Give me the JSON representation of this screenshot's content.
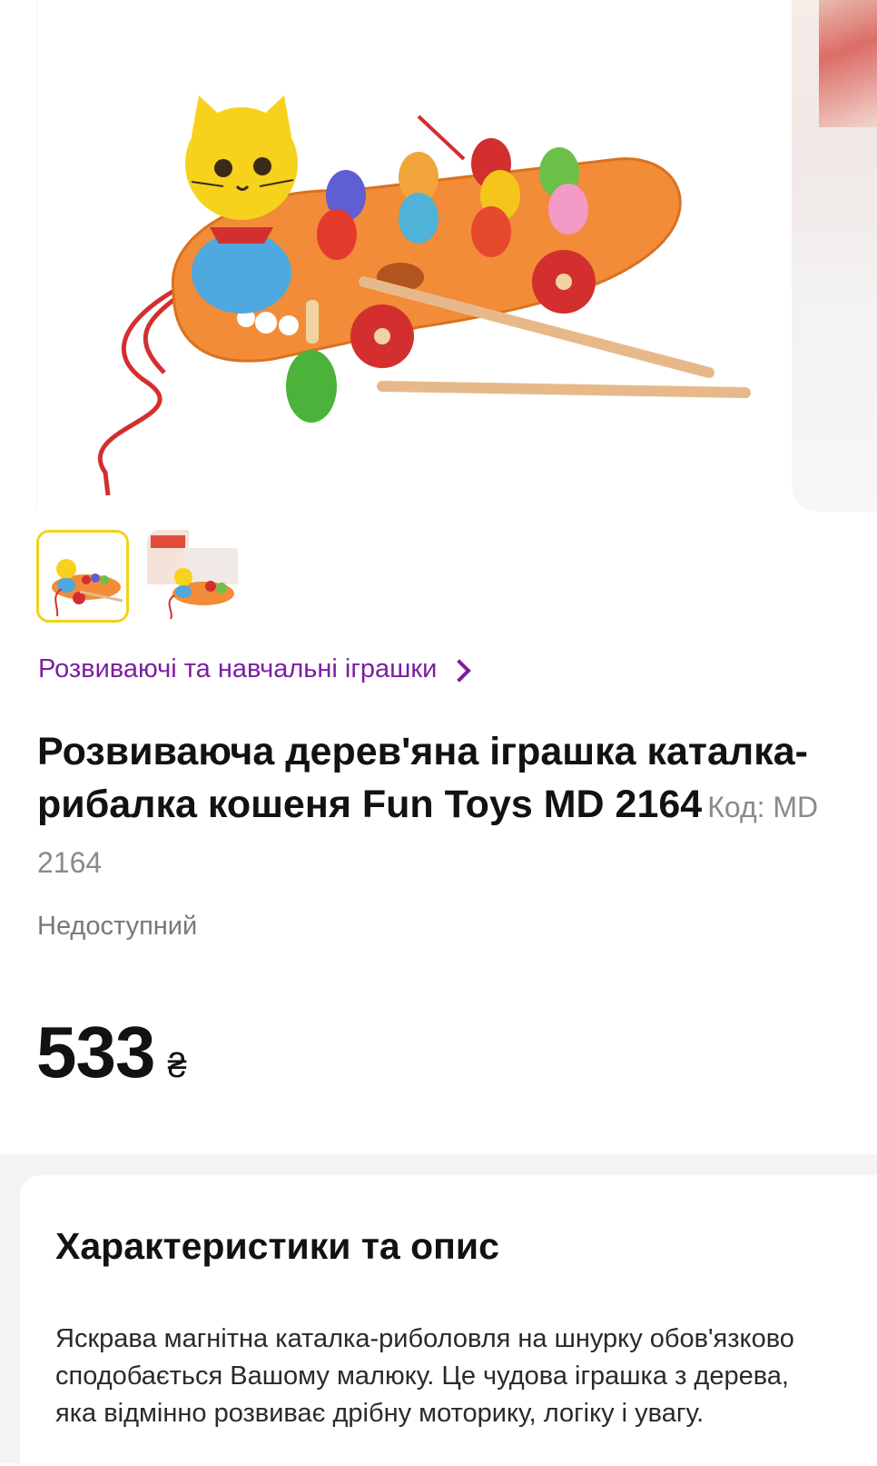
{
  "gallery": {
    "thumbnail_count": 2,
    "active_thumbnail": 1
  },
  "breadcrumb": {
    "category_label": "Розвиваючі та навчальні іграшки"
  },
  "product": {
    "title": "Розвиваюча дерев'яна іграшка каталка-рибалка кошеня Fun Toys MD 2164",
    "code_label": "Код: MD 2164",
    "availability": "Недоступний",
    "price": "533",
    "currency_symbol": "₴"
  },
  "description": {
    "heading": "Характеристики та опис",
    "text": "Яскрава магнітна каталка-риболовля на шнурку обов'язково сподобається Вашому малюку. Це чудова іграшка з дерева, яка відмінно розвиває дрібну моторику, логіку і увагу."
  },
  "colors": {
    "accent_purple": "#7b1fa2",
    "active_thumb_border": "#f2d21b",
    "muted_text": "#797878",
    "section_background": "#f3f3f6"
  }
}
